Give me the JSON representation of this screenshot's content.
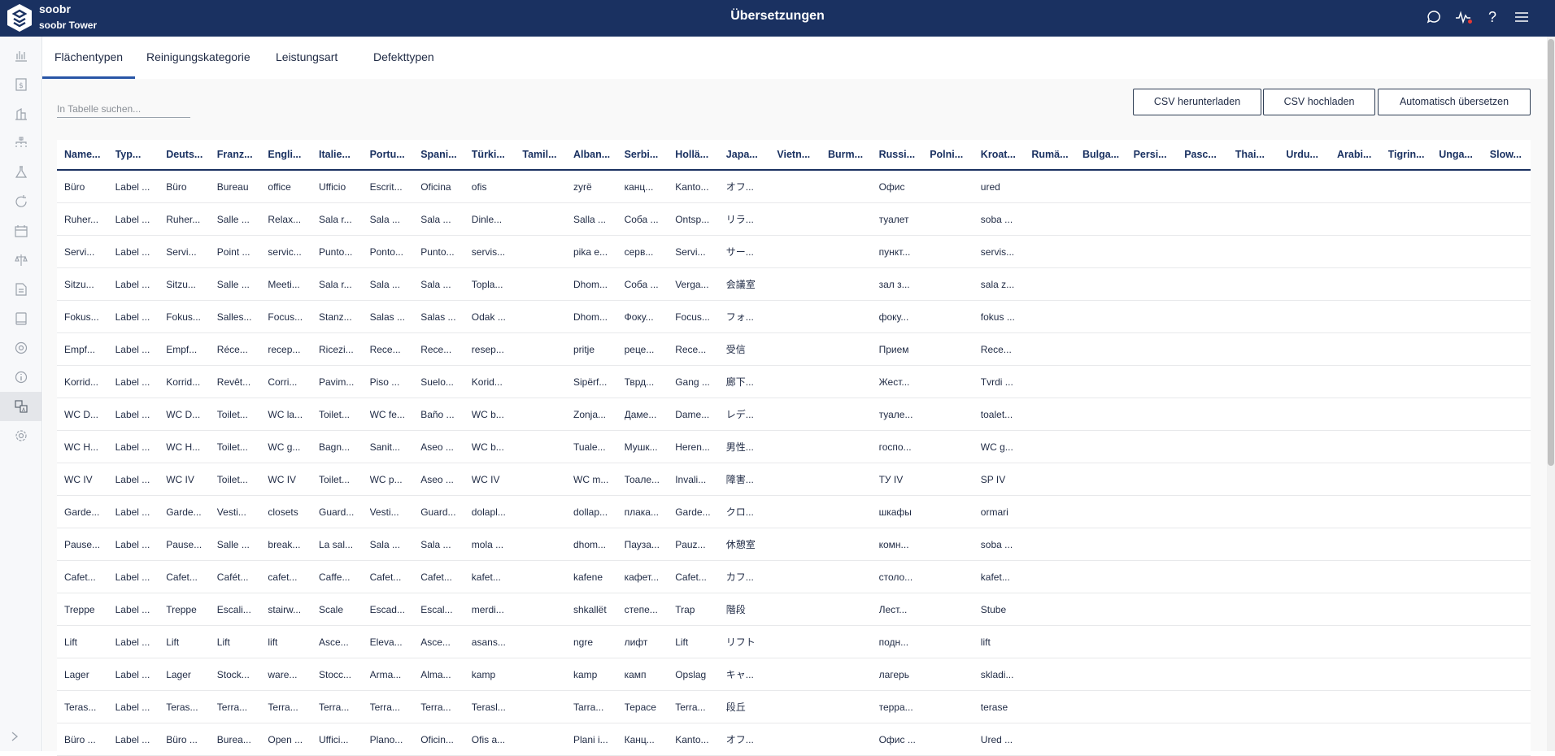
{
  "app": {
    "name": "soobr",
    "site": "soobr Tower",
    "page_title": "Übersetzungen"
  },
  "tabs": [
    "Flächentypen",
    "Reinigungskategorie",
    "Leistungsart",
    "Defekttypen"
  ],
  "search": {
    "placeholder": "In Tabelle suchen..."
  },
  "buttons": {
    "download": "CSV herunterladen",
    "upload": "CSV hochladen",
    "auto": "Automatisch übersetzen"
  },
  "icons": [
    "chat-icon",
    "activity-icon",
    "help-icon",
    "menu-icon"
  ],
  "help_glyph": "?",
  "columns": [
    "Name...",
    "Typ...",
    "Deuts...",
    "Franz...",
    "Engli...",
    "Italie...",
    "Portu...",
    "Spani...",
    "Türki...",
    "Tamil...",
    "Alban...",
    "Serbi...",
    "Hollä...",
    "Japa...",
    "Vietn...",
    "Burm...",
    "Russi...",
    "Polni...",
    "Kroat...",
    "Rumä...",
    "Bulga...",
    "Persi...",
    "Pasc...",
    "Thai...",
    "Urdu...",
    "Arabi...",
    "Tigrin...",
    "Unga...",
    "Slow..."
  ],
  "rows": [
    [
      "Büro",
      "Label ...",
      "Büro",
      "Bureau",
      "office",
      "Ufficio",
      "Escrit...",
      "Oficina",
      "ofis",
      "",
      "zyrë",
      "канц...",
      "Kanto...",
      "オフ...",
      "",
      "",
      "Офис",
      "",
      "ured"
    ],
    [
      "Ruher...",
      "Label ...",
      "Ruher...",
      "Salle ...",
      "Relax...",
      "Sala r...",
      "Sala ...",
      "Sala ...",
      "Dinle...",
      "",
      "Salla ...",
      "Соба ...",
      "Ontsp...",
      "リラ...",
      "",
      "",
      "туалет",
      "",
      "soba ..."
    ],
    [
      "Servi...",
      "Label ...",
      "Servi...",
      "Point ...",
      "servic...",
      "Punto...",
      "Ponto...",
      "Punto...",
      "servis...",
      "",
      "pika e...",
      "серв...",
      "Servi...",
      "サー...",
      "",
      "",
      "пункт...",
      "",
      "servis..."
    ],
    [
      "Sitzu...",
      "Label ...",
      "Sitzu...",
      "Salle ...",
      "Meeti...",
      "Sala r...",
      "Sala ...",
      "Sala ...",
      "Topla...",
      "",
      "Dhom...",
      "Соба ...",
      "Verga...",
      "会議室",
      "",
      "",
      "зал з...",
      "",
      "sala z..."
    ],
    [
      "Fokus...",
      "Label ...",
      "Fokus...",
      "Salles...",
      "Focus...",
      "Stanz...",
      "Salas ...",
      "Salas ...",
      "Odak ...",
      "",
      "Dhom...",
      "Фоку...",
      "Focus...",
      "フォ...",
      "",
      "",
      "фоку...",
      "",
      "fokus ..."
    ],
    [
      "Empf...",
      "Label ...",
      "Empf...",
      "Réce...",
      "recep...",
      "Ricezi...",
      "Rece...",
      "Rece...",
      "resep...",
      "",
      "pritje",
      "реце...",
      "Rece...",
      "受信",
      "",
      "",
      "Прием",
      "",
      "Rece..."
    ],
    [
      "Korrid...",
      "Label ...",
      "Korrid...",
      "Revêt...",
      "Corri...",
      "Pavim...",
      "Piso ...",
      "Suelo...",
      "Korid...",
      "",
      "Sipërf...",
      "Тврд...",
      "Gang ...",
      "廊下...",
      "",
      "",
      "Жест...",
      "",
      "Tvrdi ..."
    ],
    [
      "WC D...",
      "Label ...",
      "WC D...",
      "Toilet...",
      "WC la...",
      "Toilet...",
      "WC fe...",
      "Baño ...",
      "WC b...",
      "",
      "Zonja...",
      "Даме...",
      "Dame...",
      "レデ...",
      "",
      "",
      "туале...",
      "",
      "toalet..."
    ],
    [
      "WC H...",
      "Label ...",
      "WC H...",
      "Toilet...",
      "WC g...",
      "Bagn...",
      "Sanit...",
      "Aseo ...",
      "WC b...",
      "",
      "Tuale...",
      "Мушк...",
      "Heren...",
      "男性...",
      "",
      "",
      "госпо...",
      "",
      "WC g..."
    ],
    [
      "WC IV",
      "Label ...",
      "WC IV",
      "Toilet...",
      "WC IV",
      "Toilet...",
      "WC p...",
      "Aseo ...",
      "WC IV",
      "",
      "WC m...",
      "Тоале...",
      "Invali...",
      "障害...",
      "",
      "",
      "ТУ IV",
      "",
      "SP IV"
    ],
    [
      "Garde...",
      "Label ...",
      "Garde...",
      "Vesti...",
      "closets",
      "Guard...",
      "Vesti...",
      "Guard...",
      "dolapl...",
      "",
      "dollap...",
      "плака...",
      "Garde...",
      "クロ...",
      "",
      "",
      "шкафы",
      "",
      "ormari"
    ],
    [
      "Pause...",
      "Label ...",
      "Pause...",
      "Salle ...",
      "break...",
      "La sal...",
      "Sala ...",
      "Sala ...",
      "mola ...",
      "",
      "dhom...",
      "Пауза...",
      "Pauz...",
      "休憩室",
      "",
      "",
      "комн...",
      "",
      "soba ..."
    ],
    [
      "Cafet...",
      "Label ...",
      "Cafet...",
      "Cafét...",
      "cafet...",
      "Caffe...",
      "Cafet...",
      "Cafet...",
      "kafet...",
      "",
      "kafene",
      "кафет...",
      "Cafet...",
      "カフ...",
      "",
      "",
      "столо...",
      "",
      "kafet..."
    ],
    [
      "Treppe",
      "Label ...",
      "Treppe",
      "Escali...",
      "stairw...",
      "Scale",
      "Escad...",
      "Escal...",
      "merdi...",
      "",
      "shkallët",
      "степе...",
      "Trap",
      "階段",
      "",
      "",
      "Лест...",
      "",
      "Stube"
    ],
    [
      "Lift",
      "Label ...",
      "Lift",
      "Lift",
      "lift",
      "Asce...",
      "Eleva...",
      "Asce...",
      "asans...",
      "",
      "ngre",
      "лифт",
      "Lift",
      "リフト",
      "",
      "",
      "подн...",
      "",
      "lift"
    ],
    [
      "Lager",
      "Label ...",
      "Lager",
      "Stock...",
      "ware...",
      "Stocc...",
      "Arma...",
      "Alma...",
      "kamp",
      "",
      "kamp",
      "камп",
      "Opslag",
      "キャ...",
      "",
      "",
      "лагерь",
      "",
      "skladi..."
    ],
    [
      "Teras...",
      "Label ...",
      "Teras...",
      "Terra...",
      "Terra...",
      "Terra...",
      "Terra...",
      "Terra...",
      "Terasl...",
      "",
      "Tarra...",
      "Терасе",
      "Terra...",
      "段丘",
      "",
      "",
      "терра...",
      "",
      "terase"
    ],
    [
      "Büro ...",
      "Label ...",
      "Büro ...",
      "Burea...",
      "Open ...",
      "Uffici...",
      "Plano...",
      "Oficin...",
      "Ofis a...",
      "",
      "Plani i...",
      "Канц...",
      "Kanto...",
      "オフ...",
      "",
      "",
      "Офис ...",
      "",
      "Ured ..."
    ]
  ]
}
